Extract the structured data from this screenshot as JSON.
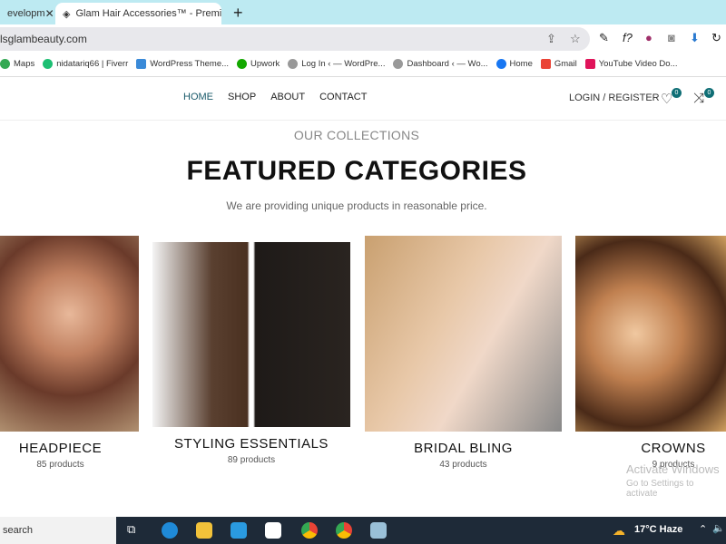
{
  "browser": {
    "tabs": [
      {
        "title": "evelopm"
      },
      {
        "title": "Glam Hair Accessories™ - Premi"
      }
    ],
    "url": "lsglambeauty.com",
    "bookmarks": [
      "Maps",
      "nidatariq66 | Fiverr",
      "WordPress Theme...",
      "Upwork",
      "Log In ‹ — WordPre...",
      "Dashboard ‹ — Wo...",
      "Home",
      "Gmail",
      "YouTube Video Do..."
    ]
  },
  "site": {
    "nav": [
      "HOME",
      "SHOP",
      "ABOUT",
      "CONTACT"
    ],
    "login": "LOGIN / REGISTER",
    "wishlist_count": "0",
    "compare_count": "0",
    "subtitle": "OUR COLLECTIONS",
    "title": "FEATURED CATEGORIES",
    "description": "We are providing unique products in reasonable price.",
    "categories": [
      {
        "name": "HEADPIECE",
        "count": "85 products"
      },
      {
        "name": "STYLING ESSENTIALS",
        "count": "89 products"
      },
      {
        "name": "BRIDAL BLING",
        "count": "43 products"
      },
      {
        "name": "CROWNS",
        "count": "9 products"
      }
    ]
  },
  "watermark": {
    "line1": "Activate Windows",
    "line2": "Go to Settings to activate"
  },
  "taskbar": {
    "search": "search",
    "weather": "17°C  Haze"
  },
  "colors": {
    "accent": "#0f6e75",
    "tabbar": "#bdeaf2"
  }
}
